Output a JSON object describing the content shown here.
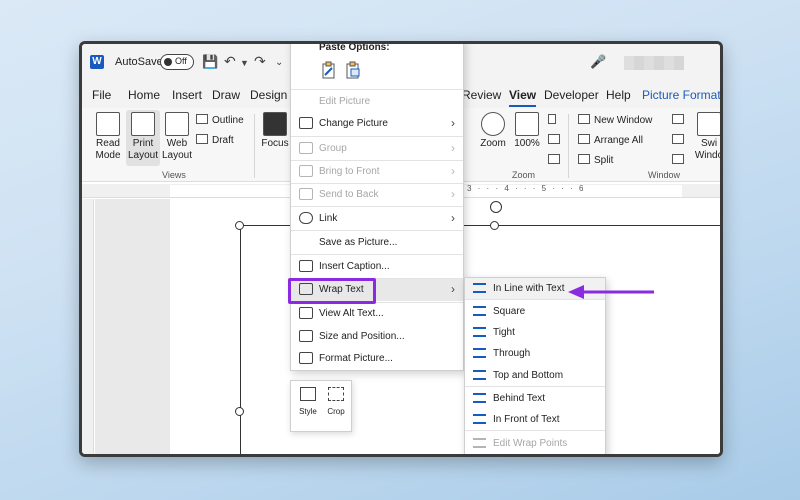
{
  "titlebar": {
    "autosave_label": "AutoSave",
    "autosave_state": "Off"
  },
  "tabs": [
    {
      "label": "File"
    },
    {
      "label": "Home"
    },
    {
      "label": "Insert"
    },
    {
      "label": "Draw"
    },
    {
      "label": "Design"
    },
    {
      "label": "Review"
    },
    {
      "label": "View"
    },
    {
      "label": "Developer"
    },
    {
      "label": "Help"
    },
    {
      "label": "Picture Format"
    }
  ],
  "ribbon": {
    "read_mode": "Read Mode",
    "print_layout": "Print Layout",
    "web_layout": "Web Layout",
    "outline": "Outline",
    "draft": "Draft",
    "focus": "Focus",
    "views_group": "Views",
    "zoom": "Zoom",
    "zoom_100": "100%",
    "zoom_group": "Zoom",
    "new_window": "New Window",
    "arrange_all": "Arrange All",
    "split": "Split",
    "window_group": "Window",
    "switch_windows": "Swi Windo"
  },
  "ruler": {
    "numbers": "3 · · · 4 · · · 5 · · · 6"
  },
  "context_menu": {
    "paste_header": "Paste Options:",
    "items": [
      {
        "label": "Edit Picture",
        "disabled": true
      },
      {
        "label": "Change Picture",
        "submenu": true
      },
      {
        "label": "Group",
        "disabled": true,
        "submenu": true
      },
      {
        "label": "Bring to Front",
        "disabled": true,
        "submenu": true
      },
      {
        "label": "Send to Back",
        "disabled": true,
        "submenu": true
      },
      {
        "label": "Link",
        "submenu": true
      },
      {
        "label": "Save as Picture..."
      },
      {
        "label": "Insert Caption..."
      },
      {
        "label": "Wrap Text",
        "submenu": true,
        "highlighted": true
      },
      {
        "label": "View Alt Text..."
      },
      {
        "label": "Size and Position..."
      },
      {
        "label": "Format Picture..."
      }
    ]
  },
  "mini_toolbar": {
    "style": "Style",
    "crop": "Crop"
  },
  "wrap_submenu": {
    "items": [
      {
        "label": "In Line with Text"
      },
      {
        "label": "Square"
      },
      {
        "label": "Tight"
      },
      {
        "label": "Through"
      },
      {
        "label": "Top and Bottom"
      },
      {
        "label": "Behind Text"
      },
      {
        "label": "In Front of Text"
      },
      {
        "label": "Edit Wrap Points",
        "disabled": true
      }
    ]
  },
  "colors": {
    "accent": "#185abd",
    "annotation": "#8a2be2"
  }
}
